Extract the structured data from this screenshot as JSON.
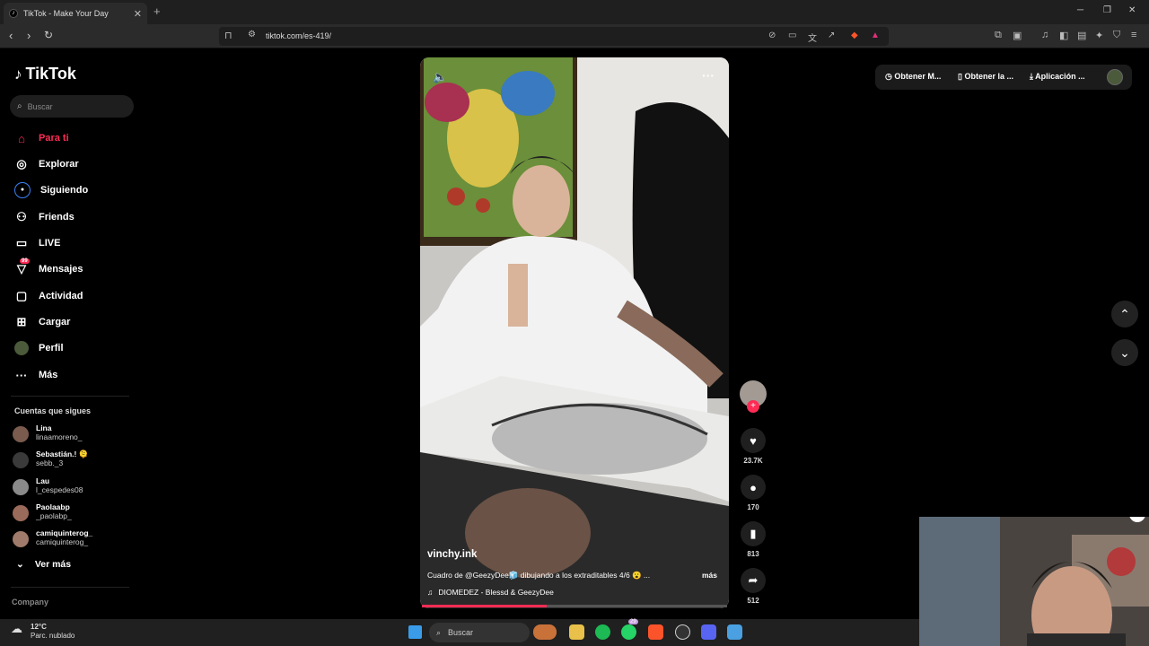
{
  "browser": {
    "tab_title": "TikTok - Make Your Day",
    "new_tab": "+",
    "url": "tiktok.com/es-419/",
    "win_min": "─",
    "win_max": "❐",
    "win_close": "✕"
  },
  "sidebar": {
    "logo": "TikTok",
    "search_placeholder": "Buscar",
    "nav": [
      {
        "label": "Para ti",
        "icon": "home-icon"
      },
      {
        "label": "Explorar",
        "icon": "compass-icon"
      },
      {
        "label": "Siguiendo",
        "icon": "following-icon"
      },
      {
        "label": "Friends",
        "icon": "friends-icon"
      },
      {
        "label": "LIVE",
        "icon": "live-icon"
      },
      {
        "label": "Mensajes",
        "icon": "messages-icon",
        "badge": "99"
      },
      {
        "label": "Actividad",
        "icon": "activity-icon"
      },
      {
        "label": "Cargar",
        "icon": "upload-icon"
      },
      {
        "label": "Perfil",
        "icon": "profile-icon"
      },
      {
        "label": "Más",
        "icon": "more-icon"
      }
    ],
    "following_title": "Cuentas que sigues",
    "accounts": [
      {
        "name": "Lina",
        "username": "linaamoreno_"
      },
      {
        "name": "Sebastián.! 🫠",
        "username": "sebb._3"
      },
      {
        "name": "Lau",
        "username": "l_cespedes08"
      },
      {
        "name": "Paolaabp",
        "username": "_paolabp_"
      },
      {
        "name": "camiquinterog_",
        "username": "camiquinterog_"
      }
    ],
    "see_more": "Ver más",
    "company": "Company"
  },
  "video": {
    "author": "vinchy.ink",
    "caption": "Cuadro de @GeezyDee🧊 dibujando a los extraditables 4/6 😮 ...",
    "more": "más",
    "music": "DIOMEDEZ - Blessd & GeezyDee",
    "progress": 0.41
  },
  "actions": {
    "likes": "23.7K",
    "comments": "170",
    "saves": "813",
    "shares": "512"
  },
  "topright": {
    "btn1": "Obtener M...",
    "btn2": "Obtener la ...",
    "btn3": "Aplicación ..."
  },
  "taskbar": {
    "temp": "12°C",
    "weather": "Parc. nublado",
    "search": "Buscar",
    "wa_badge": "29"
  },
  "colors": {
    "accent": "#fe2c55",
    "background": "#000000"
  }
}
